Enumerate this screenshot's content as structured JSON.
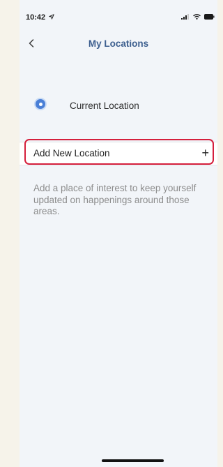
{
  "status_bar": {
    "time": "10:42",
    "location_arrow_icon": "location-arrow-icon",
    "signal_icon": "cellular-signal-icon",
    "wifi_icon": "wifi-icon",
    "battery_icon": "battery-icon"
  },
  "nav": {
    "back_icon": "chevron-left-icon",
    "title": "My Locations"
  },
  "locations": {
    "current_label": "Current Location",
    "current_icon": "current-location-dot-icon"
  },
  "add_location": {
    "label": "Add New Location",
    "plus": "+"
  },
  "helper_text": "Add a place of interest to keep yourself updated on happenings around those areas.",
  "colors": {
    "accent": "#3d5f8f",
    "location_dot": "#4a7fd6",
    "highlight": "#d51f3c",
    "background": "#f2f5f9"
  }
}
